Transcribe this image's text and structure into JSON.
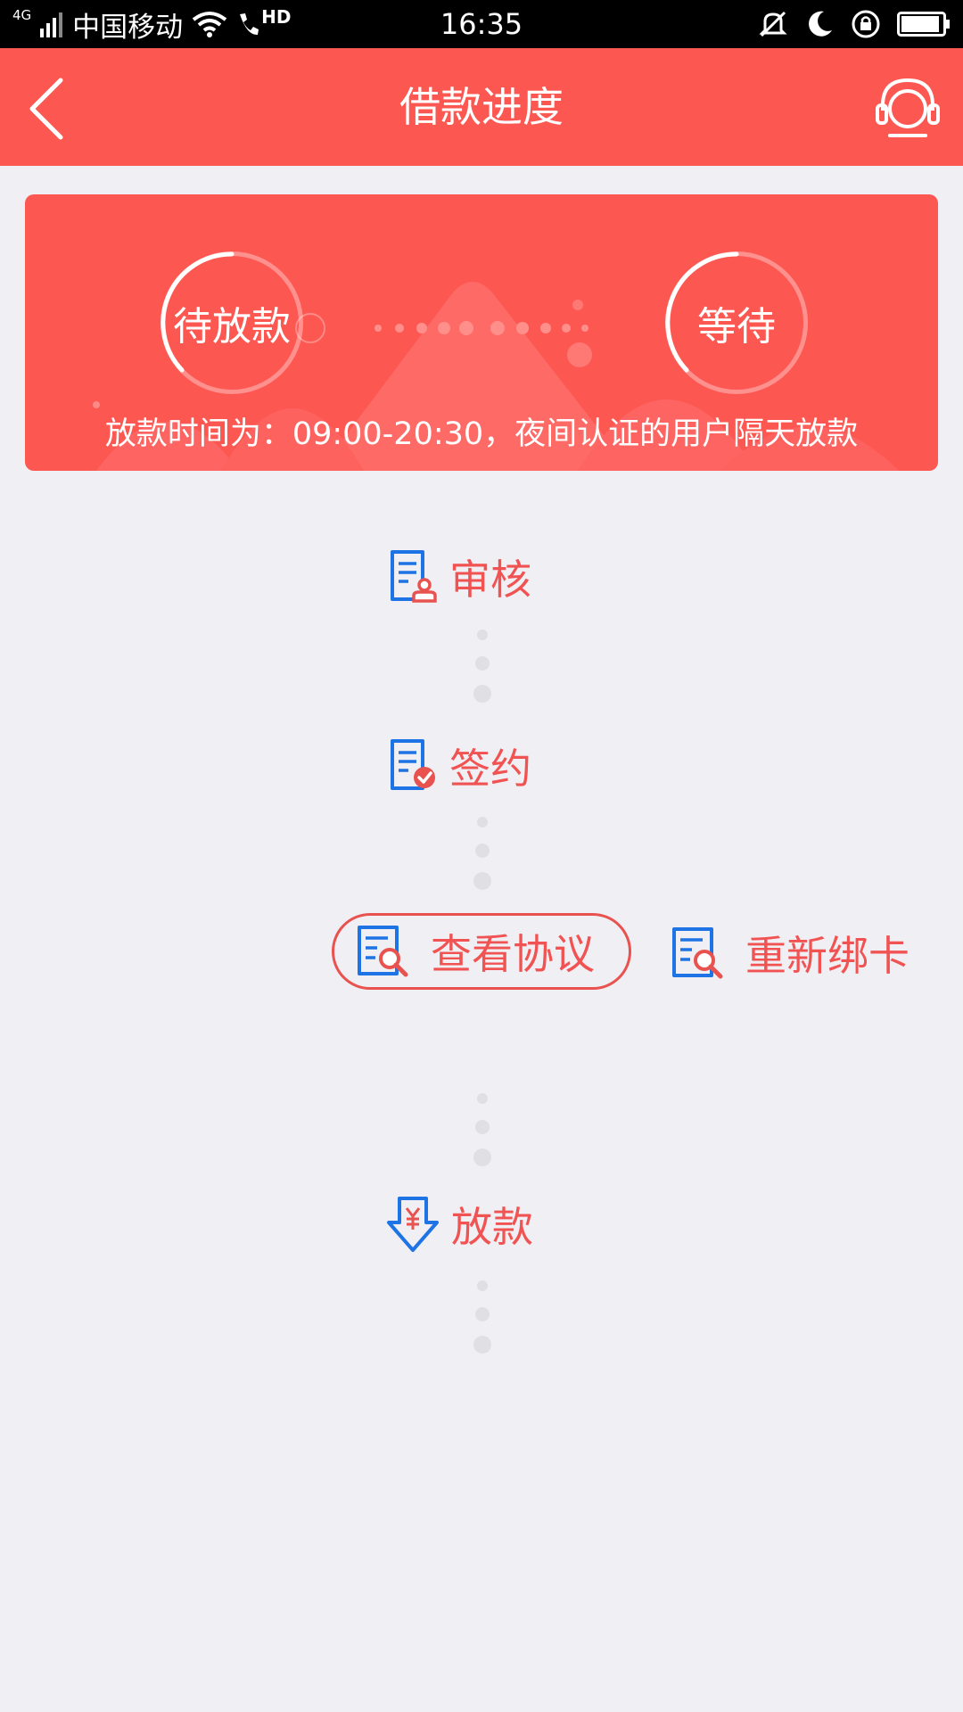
{
  "status_bar": {
    "network": "4G",
    "carrier": "中国移动",
    "time": "16:35",
    "hd": "HD"
  },
  "header": {
    "title": "借款进度"
  },
  "banner": {
    "left_stage": "待放款",
    "right_stage": "等待",
    "notice": "放款时间为：09:00-20:30，夜间认证的用户隔天放款"
  },
  "steps": {
    "review": "审核",
    "sign": "签约",
    "disburse": "放款"
  },
  "actions": {
    "view_agreement": "查看协议",
    "rebind_card": "重新绑卡"
  },
  "colors": {
    "accent": "#fd5752",
    "label": "#f05352",
    "icon_blue": "#1e74e4",
    "background": "#f0eff4"
  }
}
